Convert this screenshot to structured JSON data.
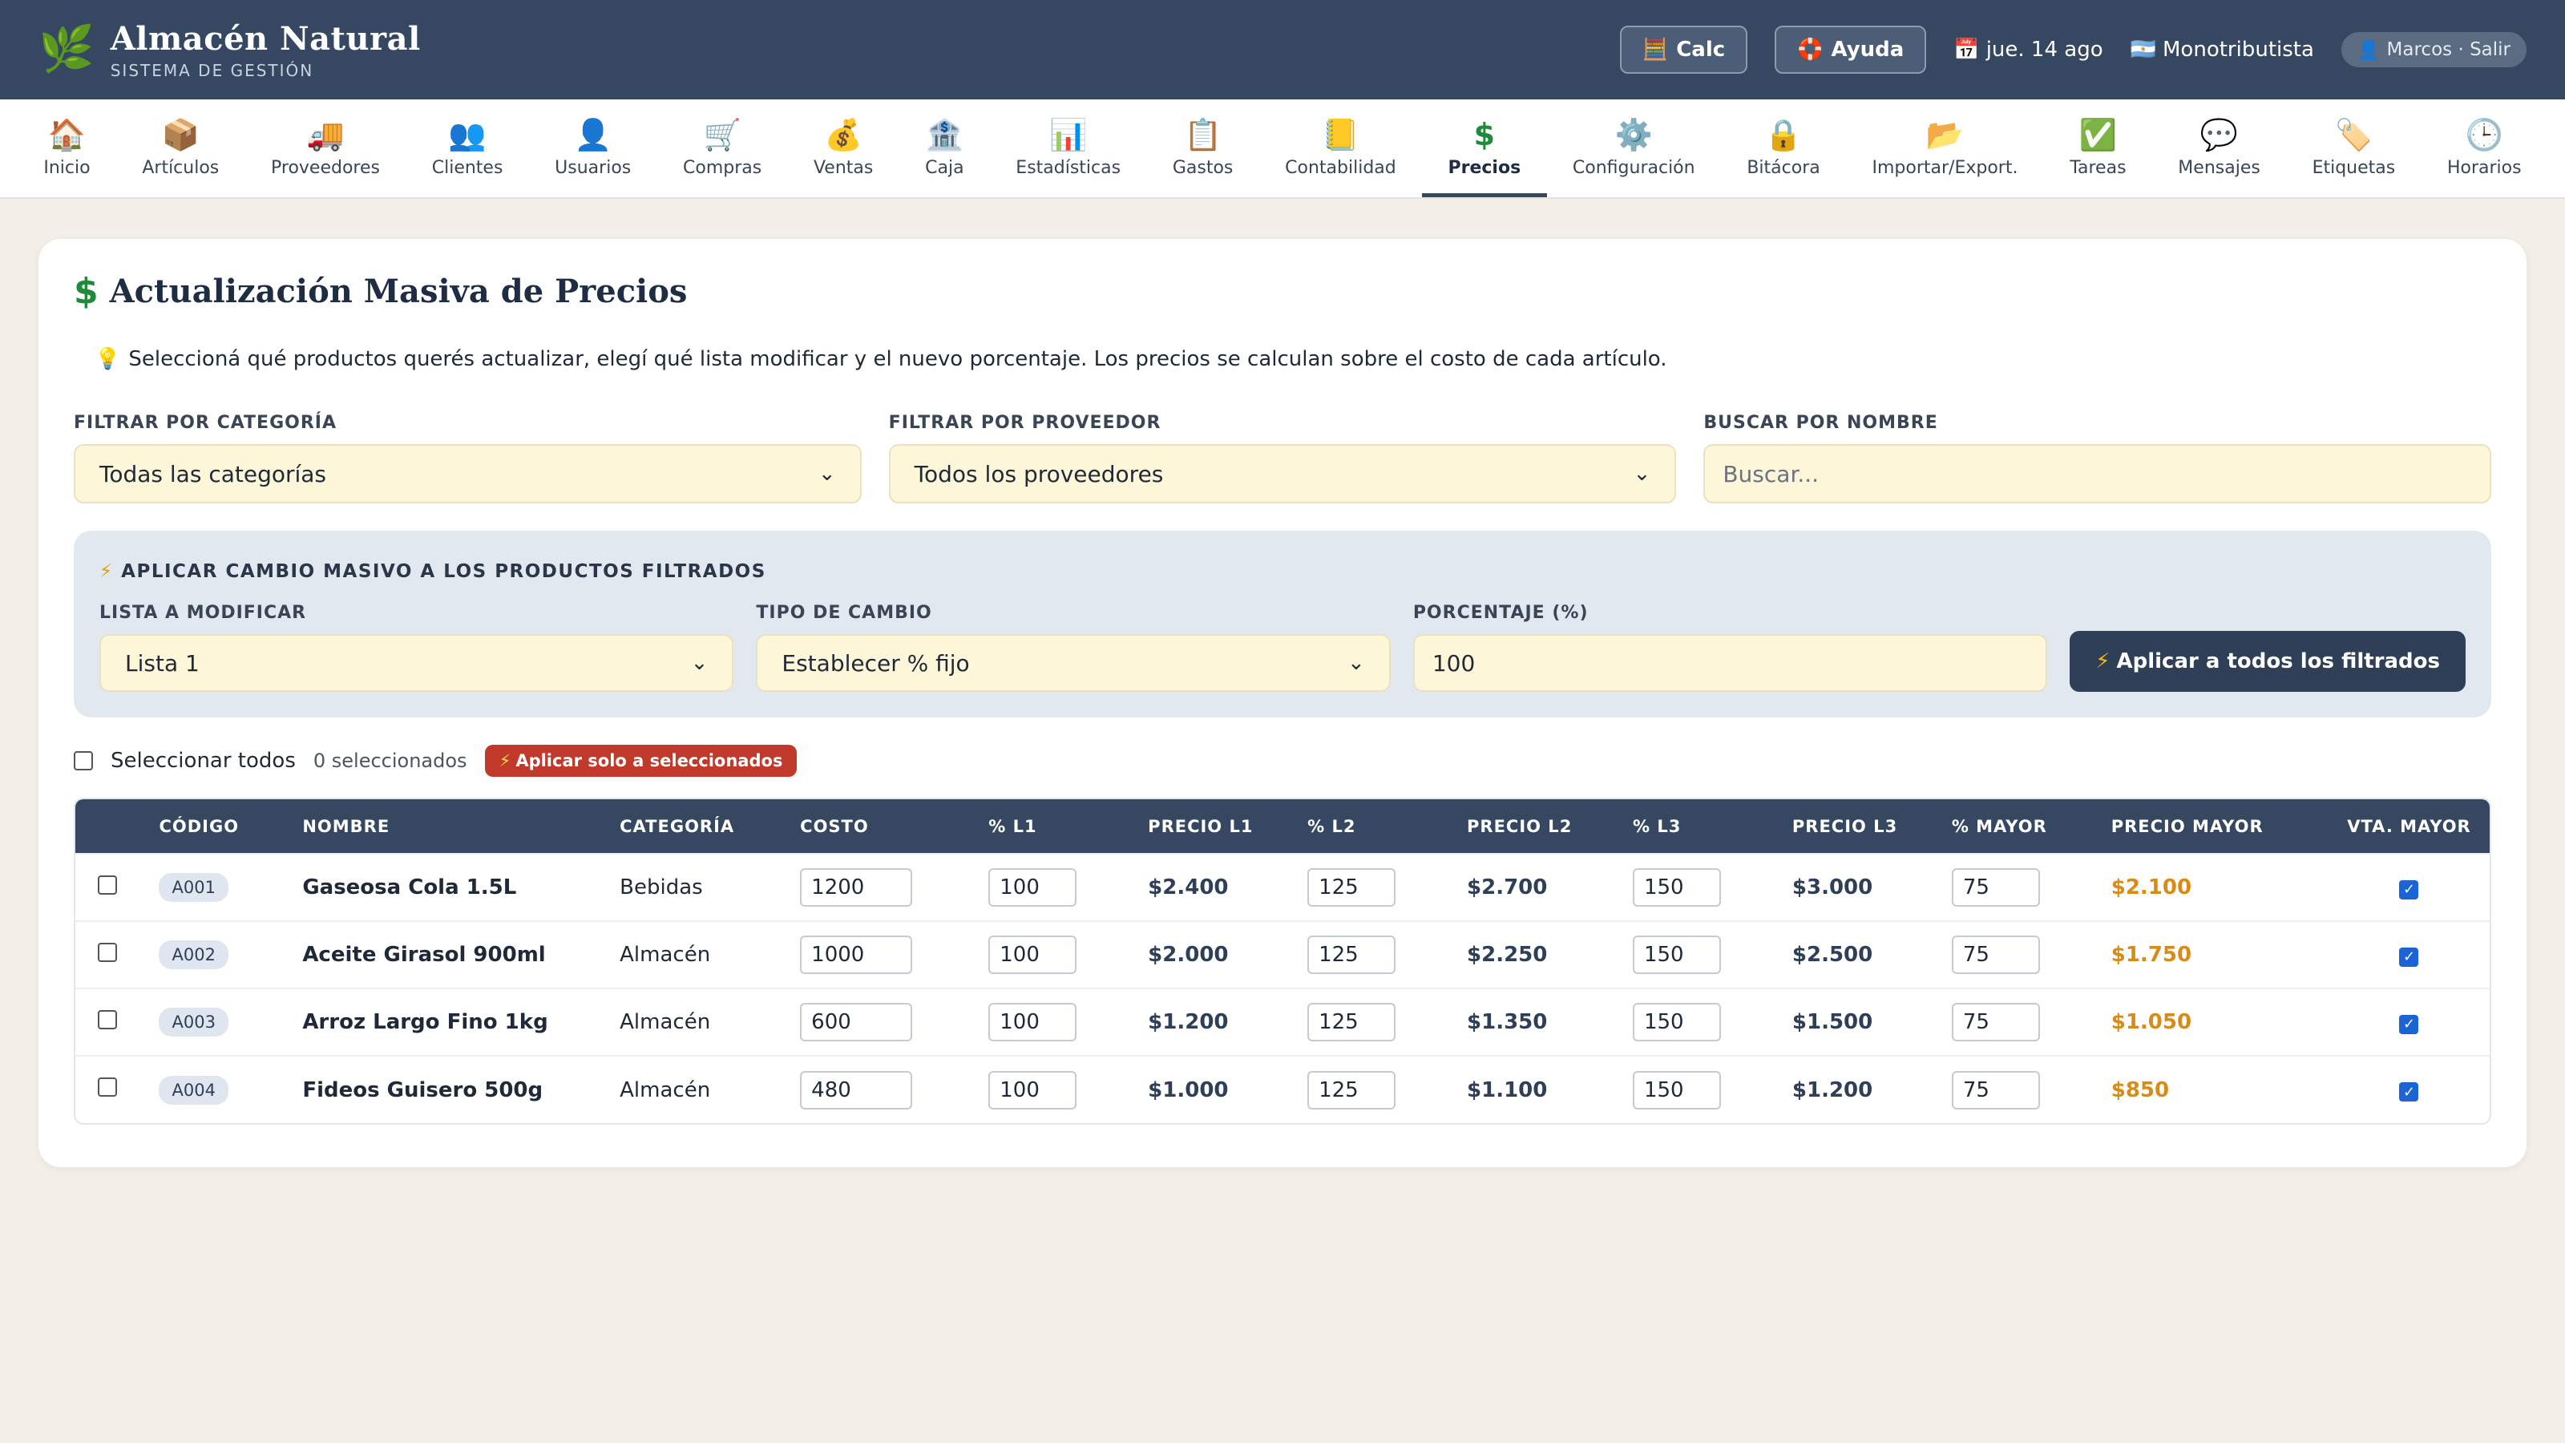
{
  "header": {
    "brand_title": "Almacén Natural",
    "brand_subtitle": "SISTEMA DE GESTIÓN",
    "calc_label": "Calc",
    "help_label": "Ayuda",
    "date": "jue. 14 ago",
    "tax_status": "Monotributista",
    "user_label": "Marcos · Salir"
  },
  "nav": {
    "items": [
      {
        "label": "Inicio",
        "icon": "🏠"
      },
      {
        "label": "Artículos",
        "icon": "📦"
      },
      {
        "label": "Proveedores",
        "icon": "🚚"
      },
      {
        "label": "Clientes",
        "icon": "👥"
      },
      {
        "label": "Usuarios",
        "icon": "👤"
      },
      {
        "label": "Compras",
        "icon": "🛒"
      },
      {
        "label": "Ventas",
        "icon": "💰"
      },
      {
        "label": "Caja",
        "icon": "🏦"
      },
      {
        "label": "Estadísticas",
        "icon": "📊"
      },
      {
        "label": "Gastos",
        "icon": "📋"
      },
      {
        "label": "Contabilidad",
        "icon": "📒"
      },
      {
        "label": "Precios",
        "icon": "$"
      },
      {
        "label": "Configuración",
        "icon": "⚙️"
      },
      {
        "label": "Bitácora",
        "icon": "🔒"
      },
      {
        "label": "Importar/Export.",
        "icon": "📂"
      },
      {
        "label": "Tareas",
        "icon": "✅"
      },
      {
        "label": "Mensajes",
        "icon": "💬"
      },
      {
        "label": "Etiquetas",
        "icon": "🏷️"
      },
      {
        "label": "Horarios",
        "icon": "🕒"
      }
    ],
    "active": "Precios"
  },
  "page": {
    "title": "Actualización Masiva de Precios",
    "hint": "Seleccioná qué productos querés actualizar, elegí qué lista modificar y el nuevo porcentaje. Los precios se calculan sobre el costo de cada artículo."
  },
  "filters": {
    "category_label": "FILTRAR POR CATEGORÍA",
    "category_value": "Todas las categorías",
    "supplier_label": "FILTRAR POR PROVEEDOR",
    "supplier_value": "Todos los proveedores",
    "search_label": "BUSCAR POR NOMBRE",
    "search_placeholder": "Buscar..."
  },
  "bulk": {
    "title": "APLICAR CAMBIO MASIVO A LOS PRODUCTOS FILTRADOS",
    "list_label": "LISTA A MODIFICAR",
    "list_value": "Lista 1",
    "type_label": "TIPO DE CAMBIO",
    "type_value": "Establecer % fijo",
    "percent_label": "PORCENTAJE (%)",
    "percent_value": "100",
    "apply_label": "Aplicar a todos los filtrados"
  },
  "selection": {
    "select_all_label": "Seleccionar todos",
    "count_label": "0 seleccionados",
    "apply_selected_label": "Aplicar solo a seleccionados"
  },
  "table": {
    "headers": [
      "CÓDIGO",
      "NOMBRE",
      "CATEGORÍA",
      "COSTO",
      "% L1",
      "PRECIO L1",
      "% L2",
      "PRECIO L2",
      "% L3",
      "PRECIO L3",
      "% MAYOR",
      "PRECIO MAYOR",
      "VTA. MAYOR"
    ],
    "rows": [
      {
        "code": "A001",
        "name": "Gaseosa Cola 1.5L",
        "category": "Bebidas",
        "cost": "1200",
        "pct_l1": "100",
        "price_l1": "$2.400",
        "pct_l2": "125",
        "price_l2": "$2.700",
        "pct_l3": "150",
        "price_l3": "$3.000",
        "pct_mayor": "75",
        "price_mayor": "$2.100",
        "vta_mayor": true,
        "selected": false
      },
      {
        "code": "A002",
        "name": "Aceite Girasol 900ml",
        "category": "Almacén",
        "cost": "1000",
        "pct_l1": "100",
        "price_l1": "$2.000",
        "pct_l2": "125",
        "price_l2": "$2.250",
        "pct_l3": "150",
        "price_l3": "$2.500",
        "pct_mayor": "75",
        "price_mayor": "$1.750",
        "vta_mayor": true,
        "selected": false
      },
      {
        "code": "A003",
        "name": "Arroz Largo Fino 1kg",
        "category": "Almacén",
        "cost": "600",
        "pct_l1": "100",
        "price_l1": "$1.200",
        "pct_l2": "125",
        "price_l2": "$1.350",
        "pct_l3": "150",
        "price_l3": "$1.500",
        "pct_mayor": "75",
        "price_mayor": "$1.050",
        "vta_mayor": true,
        "selected": false
      },
      {
        "code": "A004",
        "name": "Fideos Guisero 500g",
        "category": "Almacén",
        "cost": "480",
        "pct_l1": "100",
        "price_l1": "$1.000",
        "pct_l2": "125",
        "price_l2": "$1.100",
        "pct_l3": "150",
        "price_l3": "$1.200",
        "pct_mayor": "75",
        "price_mayor": "$850",
        "vta_mayor": true,
        "selected": false
      }
    ]
  }
}
